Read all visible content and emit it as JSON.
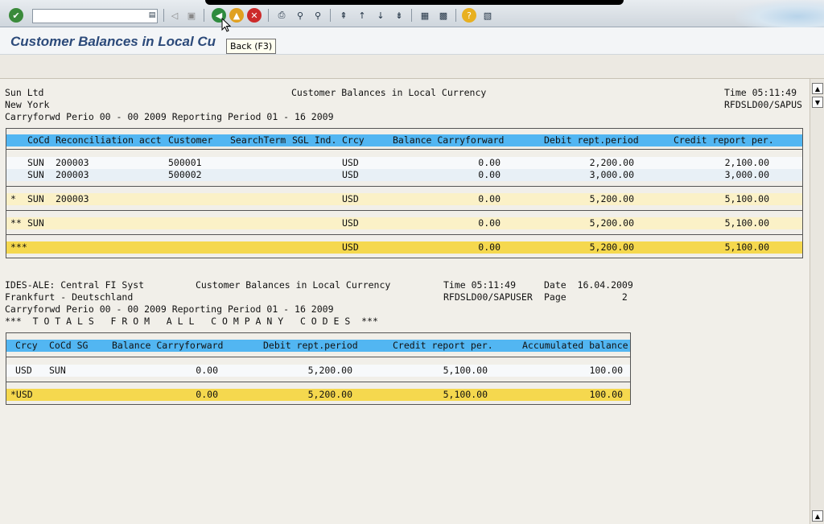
{
  "toolbar": {
    "command_value": "",
    "icons": [
      "enter-icon",
      "save-icon",
      "back-icon",
      "exit-icon",
      "cancel-icon",
      "print-icon",
      "find-icon",
      "find-next-icon",
      "first-page-icon",
      "prev-page-icon",
      "next-page-icon",
      "last-page-icon",
      "layout-icon",
      "settings-icon",
      "help-icon",
      "customize-icon"
    ]
  },
  "title": "Customer Balances in Local Cu",
  "tooltip": "Back  (F3)",
  "report1": {
    "company": "Sun Ltd",
    "city": "New York",
    "center_title": "Customer Balances in Local Currency",
    "time": "Time 05:11:49",
    "program": "RFDSLD00/SAPUS",
    "period": "Carryforwd Perio 00 - 00 2009 Reporting Period 01 - 16 2009",
    "headers": [
      "CoCd",
      "Reconciliation acct",
      "Customer",
      "SearchTerm",
      "SGL Ind.",
      "Crcy",
      "Balance Carryforward",
      "Debit rept.period",
      "Credit report per."
    ],
    "rows": [
      {
        "cocd": "SUN",
        "recon": "200003",
        "customer": "500001",
        "crcy": "USD",
        "bal": "0.00",
        "debit": "2,200.00",
        "credit": "2,100.00"
      },
      {
        "cocd": "SUN",
        "recon": "200003",
        "customer": "500002",
        "crcy": "USD",
        "bal": "0.00",
        "debit": "3,000.00",
        "credit": "3,000.00"
      }
    ],
    "sub1": {
      "mark": "*",
      "cocd": "SUN",
      "recon": "200003",
      "crcy": "USD",
      "bal": "0.00",
      "debit": "5,200.00",
      "credit": "5,100.00"
    },
    "sub2": {
      "mark": "**",
      "cocd": "SUN",
      "crcy": "USD",
      "bal": "0.00",
      "debit": "5,200.00",
      "credit": "5,100.00"
    },
    "total": {
      "mark": "***",
      "crcy": "USD",
      "bal": "0.00",
      "debit": "5,200.00",
      "credit": "5,100.00"
    }
  },
  "report2": {
    "company": "IDES-ALE: Central FI Syst",
    "city": "Frankfurt - Deutschland",
    "center_title": "Customer Balances in Local Currency",
    "time": "Time 05:11:49",
    "date": "Date  16.04.2009",
    "program": "RFDSLD00/SAPUSER",
    "page": "Page          2",
    "period": "Carryforwd Perio 00 - 00 2009 Reporting Period 01 - 16 2009",
    "totals_title": "***  T O T A L S   F R O M   A L L   C O M P A N Y   C O D E S  ***",
    "headers": [
      "Crcy",
      "CoCd SG",
      "Balance Carryforward",
      "Debit rept.period",
      "Credit report per.",
      "Accumulated balance"
    ],
    "row": {
      "crcy": "USD",
      "cocd": "SUN",
      "bal": "0.00",
      "debit": "5,200.00",
      "credit": "5,100.00",
      "acc": "100.00"
    },
    "total": {
      "crcy": "*USD",
      "bal": "0.00",
      "debit": "5,200.00",
      "credit": "5,100.00",
      "acc": "100.00"
    }
  },
  "colors": {
    "header_blue": "#52b6f2",
    "subtotal_yellow": "#fbf1c7",
    "total_yellow": "#f5d84e"
  }
}
